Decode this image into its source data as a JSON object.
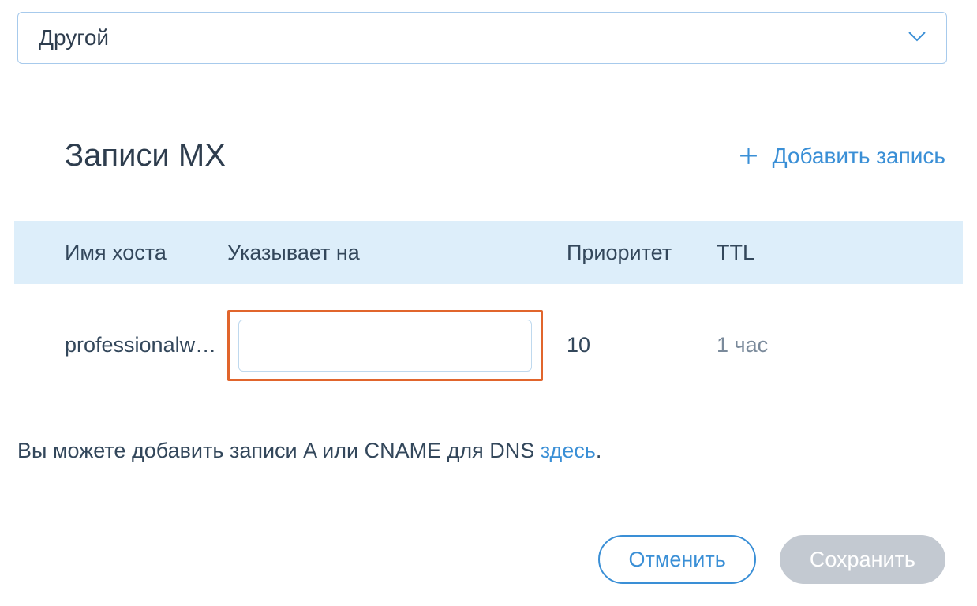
{
  "dropdown": {
    "selected_label": "Другой"
  },
  "section": {
    "title": "Записи MX",
    "add_label": "Добавить запись"
  },
  "table": {
    "headers": {
      "host": "Имя хоста",
      "points_to": "Указывает на",
      "priority": "Приоритет",
      "ttl": "TTL"
    },
    "row0": {
      "host": "professionalw…",
      "points_to_value": "",
      "priority": "10",
      "ttl": "1 час"
    }
  },
  "footnote": {
    "prefix": "Вы можете добавить записи A или CNAME для DNS ",
    "link_text": "здесь",
    "suffix": "."
  },
  "buttons": {
    "cancel": "Отменить",
    "save": "Сохранить"
  }
}
